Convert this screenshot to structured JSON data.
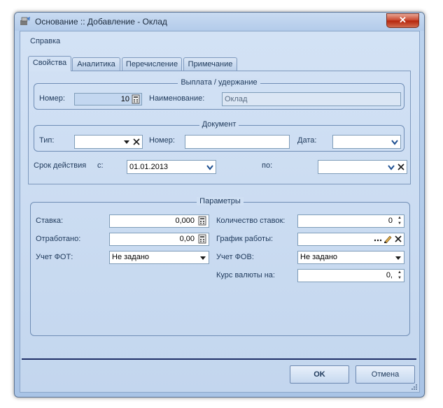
{
  "window": {
    "title": "Основание :: Добавление - Оклад",
    "close_label": "✕",
    "menu_help": "Справка"
  },
  "tabs": [
    "Свойства",
    "Аналитика",
    "Перечисление",
    "Примечание"
  ],
  "payment": {
    "group_title": "Выплата / удержание",
    "number_label": "Номер:",
    "number_value": "10",
    "name_label": "Наименование:",
    "name_value": "Оклад"
  },
  "document": {
    "group_title": "Документ",
    "type_label": "Тип:",
    "type_value": "",
    "number_label": "Номер:",
    "number_value": "",
    "date_label": "Дата:",
    "date_value": ""
  },
  "validity": {
    "label": "Срок действия",
    "from_label": "с:",
    "from_value": "01.01.2013",
    "to_label": "по:",
    "to_value": ""
  },
  "params": {
    "group_title": "Параметры",
    "rate_label": "Ставка:",
    "rate_value": "0,000",
    "worked_label": "Отработано:",
    "worked_value": "0,00",
    "fot_label": "Учет ФОТ:",
    "fot_value": "Не задано",
    "rates_count_label": "Количество ставок:",
    "rates_count_value": "0",
    "schedule_label": "График работы:",
    "schedule_value": "",
    "fov_label": "Учет ФОВ:",
    "fov_value": "Не задано",
    "currency_label": "Курс валюты на:",
    "currency_value": "0,"
  },
  "buttons": {
    "ok": "OK",
    "cancel": "Отмена"
  },
  "colors": {
    "titlebar": "#c9dbf1",
    "client": "#d3e2f5",
    "divider": "#1f2e67",
    "close": "#c7432a"
  },
  "icons": {
    "calculator": "calculator-icon",
    "dropdown": "chevron-down-icon",
    "clear": "clear-x-icon",
    "spinner": "spinner-arrows-icon",
    "ellipsis": "ellipsis-icon"
  }
}
